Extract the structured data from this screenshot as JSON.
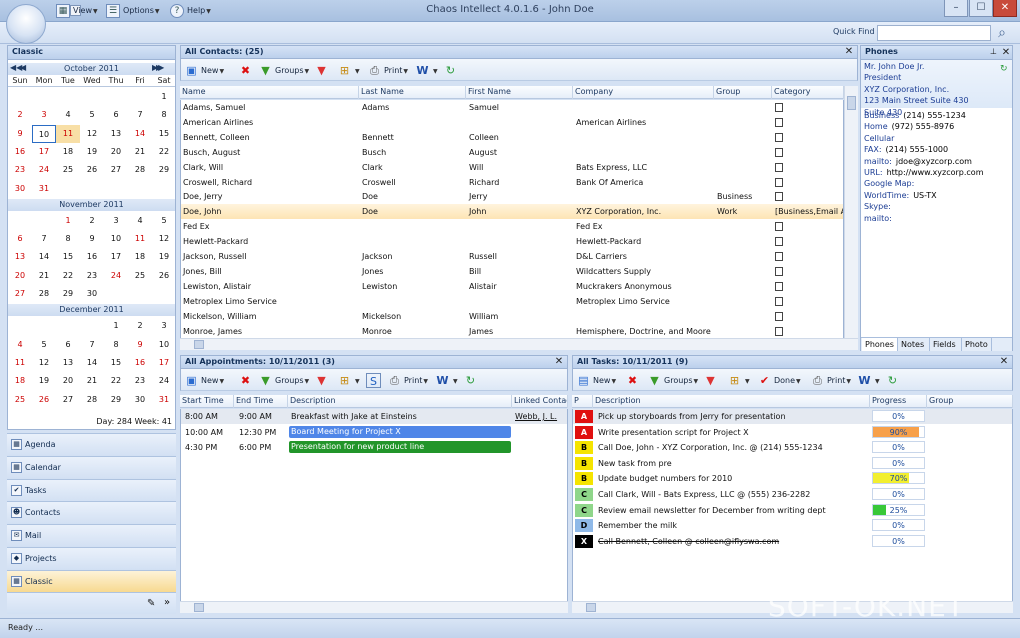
{
  "window": {
    "title": "Chaos Intellect 4.0.1.6 - John Doe",
    "min": "–",
    "max": "☐",
    "close": "✕"
  },
  "menu": {
    "view": "View",
    "options": "Options",
    "help": "Help"
  },
  "quickfind": {
    "label": "Quick Find",
    "placeholder": ""
  },
  "calendar": {
    "style_label": "Classic",
    "dow": [
      "Sun",
      "Mon",
      "Tue",
      "Wed",
      "Thu",
      "Fri",
      "Sat"
    ],
    "months": [
      {
        "name": "October 2011",
        "weeks": [
          [
            "",
            "",
            "",
            "",
            "",
            "",
            "1"
          ],
          [
            "2",
            "3",
            "4",
            "5",
            "6",
            "7",
            "8"
          ],
          [
            "9",
            "10",
            "11",
            "12",
            "13",
            "14",
            "15"
          ],
          [
            "16",
            "17",
            "18",
            "19",
            "20",
            "21",
            "22"
          ],
          [
            "23",
            "24",
            "25",
            "26",
            "27",
            "28",
            "29"
          ],
          [
            "30",
            "31",
            "",
            "",
            "",
            "",
            ""
          ]
        ]
      },
      {
        "name": "November 2011",
        "weeks": [
          [
            "",
            "",
            "1",
            "2",
            "3",
            "4",
            "5"
          ],
          [
            "6",
            "7",
            "8",
            "9",
            "10",
            "11",
            "12"
          ],
          [
            "13",
            "14",
            "15",
            "16",
            "17",
            "18",
            "19"
          ],
          [
            "20",
            "21",
            "22",
            "23",
            "24",
            "25",
            "26"
          ],
          [
            "27",
            "28",
            "29",
            "30",
            "",
            "",
            ""
          ]
        ]
      },
      {
        "name": "December 2011",
        "weeks": [
          [
            "",
            "",
            "",
            "",
            "1",
            "2",
            "3"
          ],
          [
            "4",
            "5",
            "6",
            "7",
            "8",
            "9",
            "10"
          ],
          [
            "11",
            "12",
            "13",
            "14",
            "15",
            "16",
            "17"
          ],
          [
            "18",
            "19",
            "20",
            "21",
            "22",
            "23",
            "24"
          ],
          [
            "25",
            "26",
            "27",
            "28",
            "29",
            "30",
            "31"
          ]
        ]
      }
    ],
    "footer": "Day: 284  Week: 41"
  },
  "nav": {
    "items": [
      {
        "label": "Agenda",
        "icon": "agenda-icon"
      },
      {
        "label": "Calendar",
        "icon": "calendar-icon"
      },
      {
        "label": "Tasks",
        "icon": "tasks-icon"
      },
      {
        "label": "Contacts",
        "icon": "contacts-icon"
      },
      {
        "label": "Mail",
        "icon": "mail-icon"
      },
      {
        "label": "Projects",
        "icon": "projects-icon"
      },
      {
        "label": "Classic",
        "icon": "classic-icon"
      }
    ]
  },
  "toolbar": {
    "new": "New",
    "groups": "Groups",
    "print": "Print",
    "done": "Done"
  },
  "contacts": {
    "title": "All Contacts:  (25)",
    "columns": [
      "Name",
      "Last Name",
      "First Name",
      "Company",
      "Group",
      "Category"
    ],
    "rows": [
      [
        "Adams, Samuel",
        "Adams",
        "Samuel",
        "",
        "",
        ""
      ],
      [
        "American Airlines",
        "",
        "",
        "American Airlines",
        "",
        ""
      ],
      [
        "Bennett, Colleen",
        "Bennett",
        "Colleen",
        "",
        "",
        ""
      ],
      [
        "Busch, August",
        "Busch",
        "August",
        "",
        "",
        ""
      ],
      [
        "Clark, Will",
        "Clark",
        "Will",
        "Bats Express, LLC",
        "",
        ""
      ],
      [
        "Croswell, Richard",
        "Croswell",
        "Richard",
        "Bank Of America",
        "",
        ""
      ],
      [
        "Doe, Jerry",
        "Doe",
        "Jerry",
        "",
        "Business",
        ""
      ],
      [
        "Doe, John",
        "Doe",
        "John",
        "XYZ Corporation, Inc.",
        "Work",
        "[Business,Email Anr"
      ],
      [
        "Fed Ex",
        "",
        "",
        "Fed Ex",
        "",
        ""
      ],
      [
        "Hewlett-Packard",
        "",
        "",
        "Hewlett-Packard",
        "",
        ""
      ],
      [
        "Jackson, Russell",
        "Jackson",
        "Russell",
        "D&L  Carriers",
        "",
        ""
      ],
      [
        "Jones, Bill",
        "Jones",
        "Bill",
        "Wildcatters Supply",
        "",
        ""
      ],
      [
        "Lewiston, Alistair",
        "Lewiston",
        "Alistair",
        "Muckrakers Anonymous",
        "",
        ""
      ],
      [
        "Metroplex Limo Service",
        "",
        "",
        "Metroplex Limo Service",
        "",
        ""
      ],
      [
        "Mickelson, William",
        "Mickelson",
        "William",
        "",
        "",
        ""
      ],
      [
        "Monroe, James",
        "Monroe",
        "James",
        "Hemisphere, Doctrine, and Moore",
        "",
        ""
      ]
    ],
    "selected_index": 7
  },
  "phones": {
    "title": "Phones",
    "lines": [
      "Mr. John Doe Jr.",
      "President",
      "XYZ Corporation, Inc.",
      "123 Main Street Suite 430",
      "Suite 430"
    ],
    "fields": [
      {
        "label": "Business",
        "value": "(214) 555-1234"
      },
      {
        "label": "Home",
        "value": "(972) 555-8976"
      },
      {
        "label": "Cellular",
        "value": ""
      },
      {
        "label": "FAX:",
        "value": "(214) 555-1000"
      },
      {
        "label": "mailto:",
        "value": "jdoe@xyzcorp.com"
      },
      {
        "label": "URL:",
        "value": "http://www.xyzcorp.com"
      },
      {
        "label": "Google Map:",
        "value": ""
      },
      {
        "label": "WorldTime:",
        "value": "US-TX"
      },
      {
        "label": "Skype:",
        "value": ""
      },
      {
        "label": "mailto:",
        "value": ""
      }
    ],
    "tabs": [
      "Phones",
      "Notes",
      "Fields",
      "Photo"
    ]
  },
  "appointments": {
    "title": "All Appointments: 10/11/2011  (3)",
    "columns": [
      "Start Time",
      "End Time",
      "Description",
      "Linked Contac"
    ],
    "rows": [
      {
        "start": "8:00 AM",
        "end": "9:00 AM",
        "desc": "Breakfast with Jake at Einsteins",
        "linked": "Webb, J. L.",
        "color": ""
      },
      {
        "start": "10:00 AM",
        "end": "12:30 PM",
        "desc": "Board Meeting for Project X",
        "linked": "",
        "color": "#4f86e8"
      },
      {
        "start": "4:30 PM",
        "end": "6:00 PM",
        "desc": "Presentation for new product line",
        "linked": "",
        "color": "#22952a"
      }
    ]
  },
  "tasks": {
    "title": "All Tasks: 10/11/2011  (9)",
    "columns": [
      "P",
      "Description",
      "Progress",
      "Group"
    ],
    "rows": [
      {
        "p": "A",
        "pcolor": "#e01010",
        "pfg": "#fff",
        "desc": "Pick up storyboards from Jerry for presentation",
        "progress": 0,
        "ptext": "0%",
        "fill": "#f7a04a",
        "strike": false
      },
      {
        "p": "A",
        "pcolor": "#e01010",
        "pfg": "#fff",
        "desc": "Write presentation script for Project X",
        "progress": 90,
        "ptext": "90%",
        "fill": "#f7a04a",
        "strike": false
      },
      {
        "p": "B",
        "pcolor": "#f5e400",
        "pfg": "#000",
        "desc": "Call Doe, John - XYZ Corporation, Inc. @ (214) 555-1234",
        "progress": 0,
        "ptext": "0%",
        "fill": "#f5e400",
        "strike": false
      },
      {
        "p": "B",
        "pcolor": "#f5e400",
        "pfg": "#000",
        "desc": "New task from pre",
        "progress": 0,
        "ptext": "0%",
        "fill": "#f5e400",
        "strike": false
      },
      {
        "p": "B",
        "pcolor": "#f5e400",
        "pfg": "#000",
        "desc": "Update budget numbers for 2010",
        "progress": 70,
        "ptext": "70%",
        "fill": "#f2ef30",
        "strike": false
      },
      {
        "p": "C",
        "pcolor": "#8fd68a",
        "pfg": "#000",
        "desc": "Call Clark, Will - Bats Express, LLC @ (555) 236-2282",
        "progress": 0,
        "ptext": "0%",
        "fill": "#38c838",
        "strike": false
      },
      {
        "p": "C",
        "pcolor": "#8fd68a",
        "pfg": "#000",
        "desc": "Review email newsletter for December from writing dept",
        "progress": 25,
        "ptext": "25%",
        "fill": "#38c838",
        "strike": false
      },
      {
        "p": "D",
        "pcolor": "#8fb9e8",
        "pfg": "#000",
        "desc": "Remember the milk",
        "progress": 0,
        "ptext": "0%",
        "fill": "#8fb9e8",
        "strike": false
      },
      {
        "p": "X",
        "pcolor": "#000000",
        "pfg": "#fff",
        "desc": "Call Bennett, Colleen @ colleen@iflyswa.com",
        "progress": 0,
        "ptext": "0%",
        "fill": "#888",
        "strike": true
      }
    ]
  },
  "status": {
    "text": "Ready ..."
  },
  "watermark": "SOFT-OK.NET"
}
